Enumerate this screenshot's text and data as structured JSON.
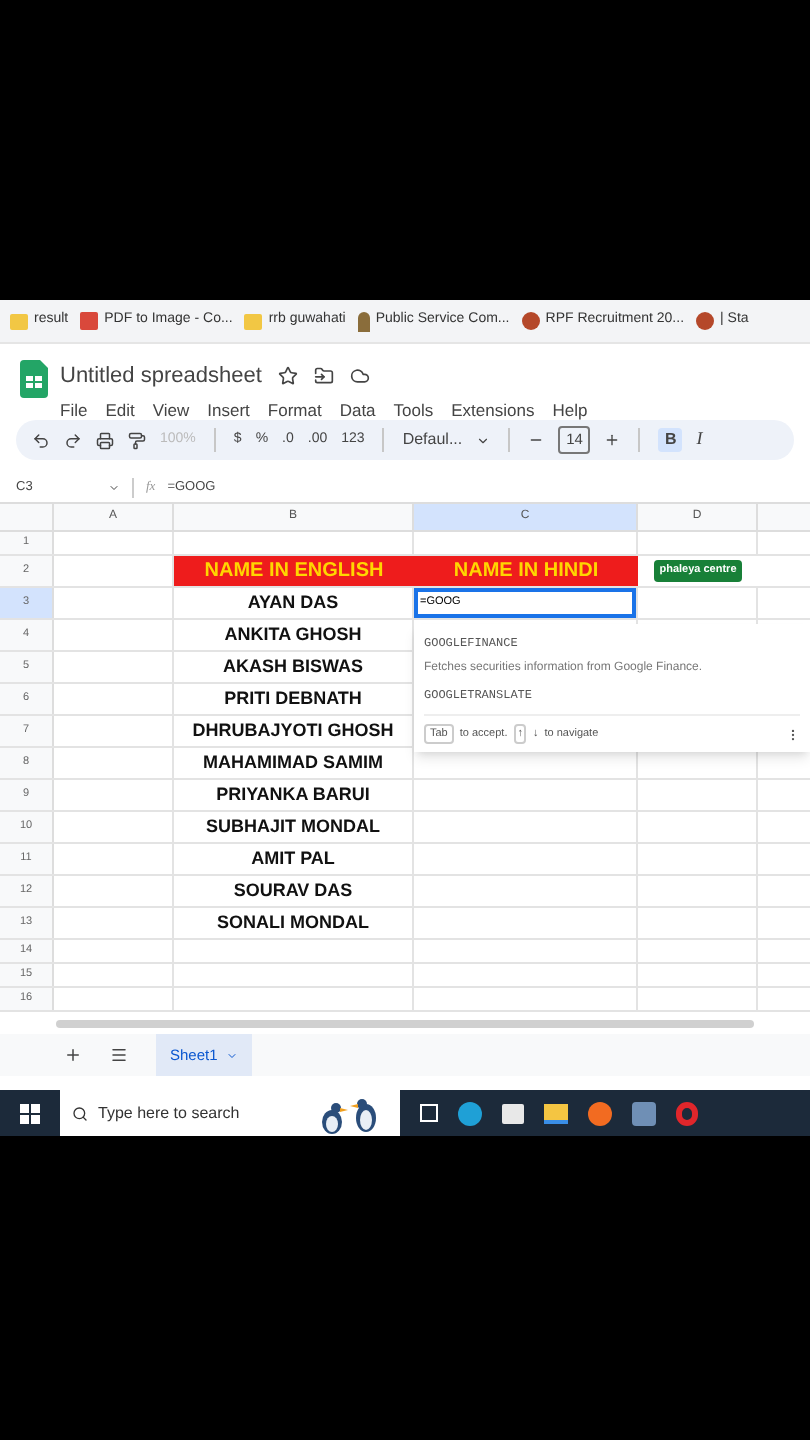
{
  "bookmarks": [
    {
      "label": "result",
      "kind": "folder"
    },
    {
      "label": "PDF to Image - Co...",
      "kind": "pdf"
    },
    {
      "label": "rrb guwahati",
      "kind": "folder"
    },
    {
      "label": "Public Service Com...",
      "kind": "emblem"
    },
    {
      "label": "RPF Recruitment 20...",
      "kind": "person"
    },
    {
      "label": "| Sta",
      "kind": "person"
    }
  ],
  "title": "Untitled spreadsheet",
  "menu": [
    "File",
    "Edit",
    "View",
    "Insert",
    "Format",
    "Data",
    "Tools",
    "Extensions",
    "Help"
  ],
  "toolbar": {
    "zoom": "100%",
    "currency": "$",
    "percent": "%",
    "decrease_decimal": ".0",
    "increase_decimal": ".00",
    "number_format": "123",
    "font": "Defaul...",
    "font_size": "14",
    "bold": "B",
    "italic": "I",
    "bold_on": true
  },
  "formula_bar": {
    "cell_ref": "C3",
    "fx": "fx",
    "formula": "=GOOG"
  },
  "columns": [
    {
      "label": "A",
      "selected": false
    },
    {
      "label": "B",
      "selected": false
    },
    {
      "label": "C",
      "selected": true
    },
    {
      "label": "D",
      "selected": false
    }
  ],
  "rows": [
    {
      "number": "1",
      "selected": false,
      "cells": []
    },
    {
      "number": "2",
      "selected": false,
      "kind": "header",
      "cells": [
        "NAME IN ENGLISH",
        "NAME IN HINDI"
      ],
      "chip": "phaleya centre"
    },
    {
      "number": "3",
      "selected": true,
      "cells": [
        "AYAN DAS"
      ],
      "editing": "=GOOG"
    },
    {
      "number": "4",
      "selected": false,
      "cells": [
        "ANKITA GHOSH"
      ]
    },
    {
      "number": "5",
      "selected": false,
      "cells": [
        "AKASH BISWAS"
      ]
    },
    {
      "number": "6",
      "selected": false,
      "cells": [
        "PRITI DEBNATH"
      ]
    },
    {
      "number": "7",
      "selected": false,
      "cells": [
        "DHRUBAJYOTI GHOSH"
      ]
    },
    {
      "number": "8",
      "selected": false,
      "cells": [
        "MAHAMIMAD SAMIM"
      ]
    },
    {
      "number": "9",
      "selected": false,
      "cells": [
        "PRIYANKA BARUI"
      ]
    },
    {
      "number": "10",
      "selected": false,
      "cells": [
        "SUBHAJIT MONDAL"
      ]
    },
    {
      "number": "11",
      "selected": false,
      "cells": [
        "AMIT PAL"
      ]
    },
    {
      "number": "12",
      "selected": false,
      "cells": [
        "SOURAV DAS"
      ]
    },
    {
      "number": "13",
      "selected": false,
      "cells": [
        "SONALI MONDAL"
      ]
    },
    {
      "number": "14",
      "selected": false,
      "cells": []
    },
    {
      "number": "15",
      "selected": false,
      "cells": []
    },
    {
      "number": "16",
      "selected": false,
      "cells": []
    }
  ],
  "suggestions": [
    {
      "name": "GOOGLEFINANCE",
      "description": "Fetches securities information from Google Finance."
    },
    {
      "name": "GOOGLETRANSLATE"
    }
  ],
  "hint": {
    "key": "Tab",
    "accept": "to accept.",
    "up": "↑",
    "down": "↓",
    "navigate": "to navigate"
  },
  "sheets": [
    {
      "label": "Sheet1",
      "selected": true
    }
  ],
  "taskbar": {
    "search_placeholder": "Type here to search"
  }
}
